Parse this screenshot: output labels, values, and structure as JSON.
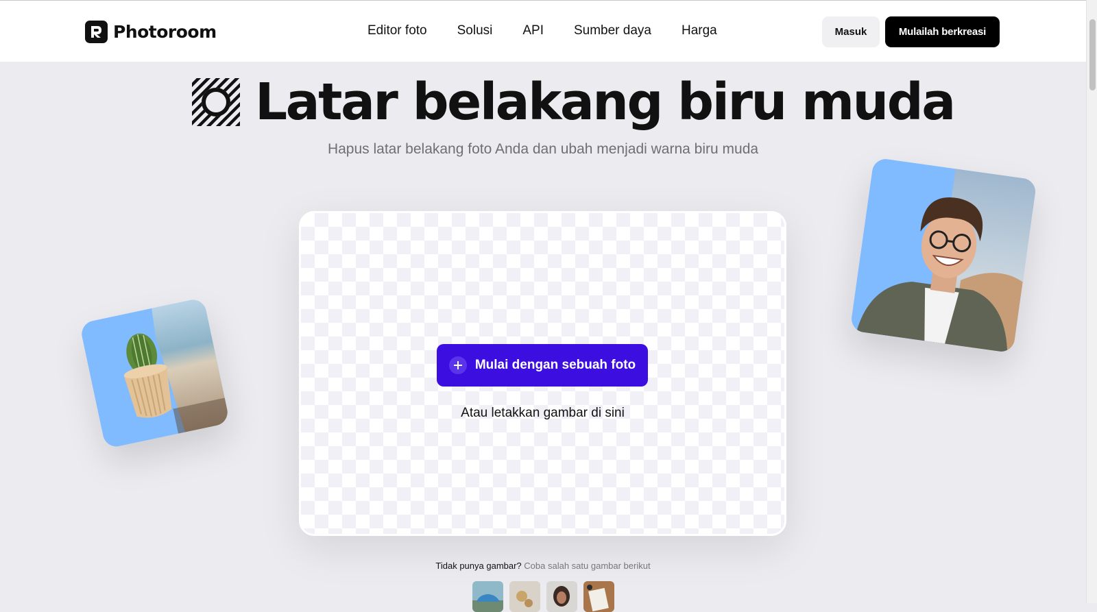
{
  "header": {
    "brand": "Photoroom",
    "nav": [
      "Editor foto",
      "Solusi",
      "API",
      "Sumber daya",
      "Harga"
    ],
    "login_label": "Masuk",
    "cta_label": "Mulailah berkreasi"
  },
  "hero": {
    "title": "Latar belakang biru muda",
    "subtitle": "Hapus latar belakang foto Anda dan ubah menjadi warna biru muda"
  },
  "upload": {
    "button_label": "Mulai dengan sebuah foto",
    "drop_hint": "Atau letakkan gambar di sini"
  },
  "samples": {
    "prompt": "Tidak punya gambar?",
    "prompt_link": "Coba salah satu gambar berikut",
    "items": [
      "car-sample",
      "object-sample",
      "portrait-sample",
      "desk-sample"
    ]
  },
  "colors": {
    "accent": "#3c0fe0",
    "light_blue": "#80baff",
    "page_bg": "#ecebf0"
  }
}
